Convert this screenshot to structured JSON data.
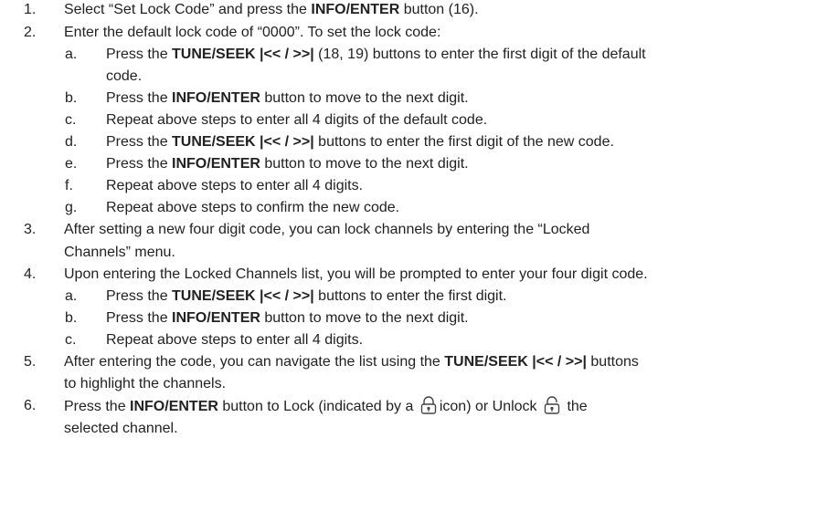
{
  "steps": [
    {
      "number": "1.",
      "segments": [
        {
          "text": "Select “Set Lock Code” and press the ",
          "bold": false
        },
        {
          "text": "INFO/ENTER",
          "bold": true
        },
        {
          "text": " button (16).",
          "bold": false
        }
      ]
    },
    {
      "number": "2.",
      "segments": [
        {
          "text": "Enter the default lock code of “0000”. To set the lock code:",
          "bold": false
        }
      ],
      "substeps": [
        {
          "letter": "a.",
          "lines": [
            [
              {
                "text": "Press the ",
                "bold": false
              },
              {
                "text": "TUNE/SEEK |<< / >>|",
                "bold": true
              },
              {
                "text": " (18, 19) buttons to enter the first digit of the default",
                "bold": false
              }
            ],
            [
              {
                "text": "code.",
                "bold": false
              }
            ]
          ]
        },
        {
          "letter": "b.",
          "lines": [
            [
              {
                "text": "Press the ",
                "bold": false
              },
              {
                "text": "INFO/ENTER",
                "bold": true
              },
              {
                "text": " button to move to the next digit.",
                "bold": false
              }
            ]
          ]
        },
        {
          "letter": "c.",
          "lines": [
            [
              {
                "text": "Repeat above steps to enter all 4 digits of the default code.",
                "bold": false
              }
            ]
          ]
        },
        {
          "letter": "d.",
          "lines": [
            [
              {
                "text": "Press the ",
                "bold": false
              },
              {
                "text": "TUNE/SEEK |<< / >>|",
                "bold": true
              },
              {
                "text": " buttons to enter the first digit of the new code.",
                "bold": false
              }
            ]
          ]
        },
        {
          "letter": "e.",
          "lines": [
            [
              {
                "text": "Press the ",
                "bold": false
              },
              {
                "text": "INFO/ENTER",
                "bold": true
              },
              {
                "text": " button to move to the next digit.",
                "bold": false
              }
            ]
          ]
        },
        {
          "letter": "f.",
          "lines": [
            [
              {
                "text": "Repeat above steps to enter all 4 digits.",
                "bold": false
              }
            ]
          ]
        },
        {
          "letter": "g.",
          "lines": [
            [
              {
                "text": "Repeat above steps to confirm the new code.",
                "bold": false
              }
            ]
          ]
        }
      ]
    },
    {
      "number": "3.",
      "lines": [
        [
          {
            "text": "After setting a new four digit code, you can lock channels by entering the “Locked",
            "bold": false
          }
        ],
        [
          {
            "text": "Channels” menu.",
            "bold": false
          }
        ]
      ]
    },
    {
      "number": "4.",
      "segments": [
        {
          "text": "Upon entering the Locked Channels list, you will be prompted to enter your four digit code.",
          "bold": false
        }
      ],
      "substeps": [
        {
          "letter": "a.",
          "lines": [
            [
              {
                "text": "Press the ",
                "bold": false
              },
              {
                "text": "TUNE/SEEK |<< / >>|",
                "bold": true
              },
              {
                "text": " buttons to enter the first digit.",
                "bold": false
              }
            ]
          ]
        },
        {
          "letter": "b.",
          "lines": [
            [
              {
                "text": "Press the ",
                "bold": false
              },
              {
                "text": "INFO/ENTER",
                "bold": true
              },
              {
                "text": " button to move to the next digit.",
                "bold": false
              }
            ]
          ]
        },
        {
          "letter": "c.",
          "lines": [
            [
              {
                "text": "Repeat above steps to enter all 4 digits.",
                "bold": false
              }
            ]
          ]
        }
      ]
    },
    {
      "number": "5.",
      "lines": [
        [
          {
            "text": "After entering the code, you can navigate the list using the ",
            "bold": false
          },
          {
            "text": "TUNE/SEEK |<< / >>|",
            "bold": true
          },
          {
            "text": " buttons",
            "bold": false
          }
        ],
        [
          {
            "text": "to highlight the channels.",
            "bold": false
          }
        ]
      ]
    },
    {
      "number": "6.",
      "lines": [
        [
          {
            "text": "Press the ",
            "bold": false
          },
          {
            "text": "INFO/ENTER",
            "bold": true
          },
          {
            "text": " button to Lock (indicated by a ",
            "bold": false
          },
          {
            "icon": "locked-padlock-icon"
          },
          {
            "text": "icon) or Unlock ",
            "bold": false
          },
          {
            "icon": "unlocked-padlock-icon"
          },
          {
            "text": " the",
            "bold": false
          }
        ],
        [
          {
            "text": "selected channel.",
            "bold": false
          }
        ]
      ]
    }
  ]
}
